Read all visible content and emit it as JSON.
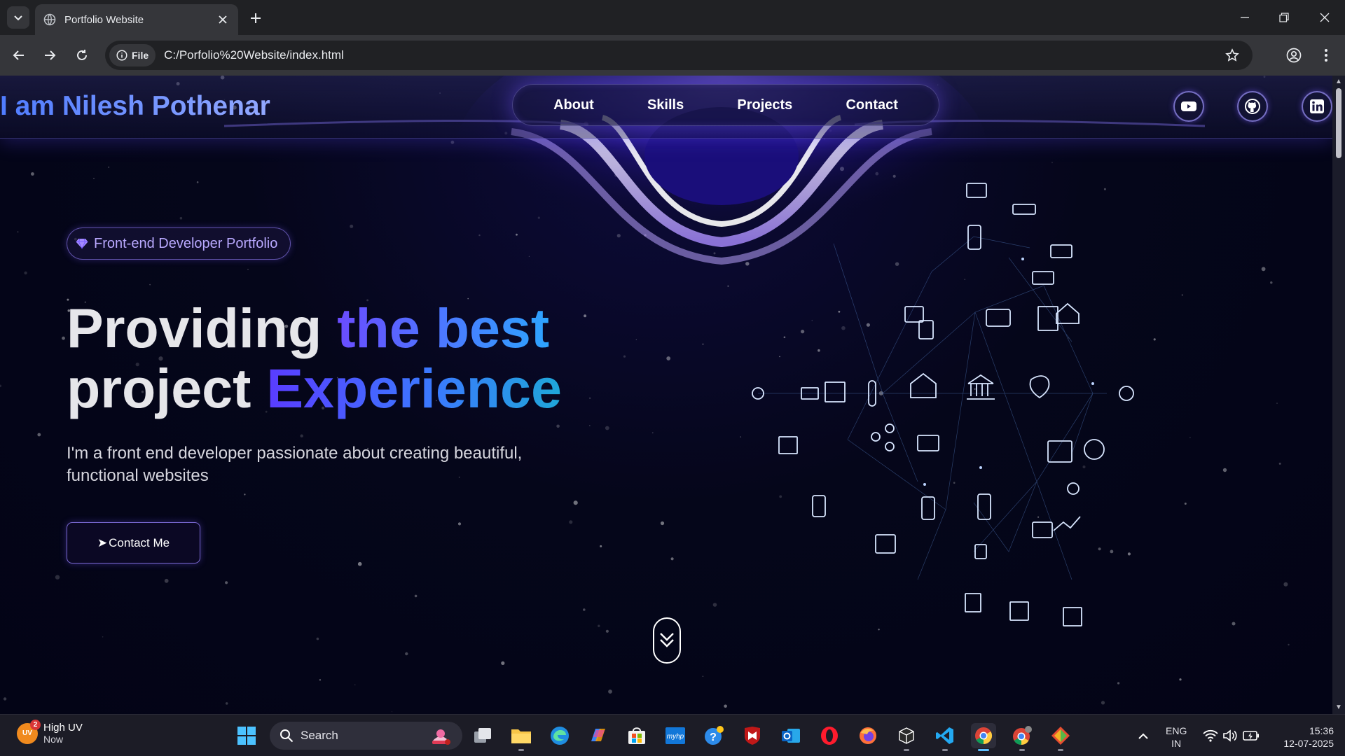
{
  "browser": {
    "tab_title": "Portfolio Website",
    "file_chip": "File",
    "url": "C:/Porfolio%20Website/index.html"
  },
  "site": {
    "brand": "I am Nilesh Pothenar",
    "nav": [
      "About",
      "Skills",
      "Projects",
      "Contact"
    ],
    "social_icons": [
      "youtube-icon",
      "github-icon",
      "linkedin-icon"
    ],
    "badge": "Front-end Developer Portfolio",
    "hero": {
      "line1_plain": "Providing ",
      "line1_grad": "the best",
      "line2_plain": "project ",
      "line2_grad": "Experience",
      "subtitle": "I'm a front end developer passionate about creating beautiful, functional websites",
      "cta": "Contact Me"
    }
  },
  "taskbar": {
    "weather_title": "High UV",
    "weather_sub": "Now",
    "weather_badge": "UV",
    "notification_count": "2",
    "search_label": "Search",
    "lang_1": "ENG",
    "lang_2": "IN",
    "time": "15:36",
    "date": "12-07-2025"
  },
  "colors": {
    "page_bg": "#05061a",
    "accent": "#6a4cff",
    "accent_blue": "#2da4ff"
  }
}
